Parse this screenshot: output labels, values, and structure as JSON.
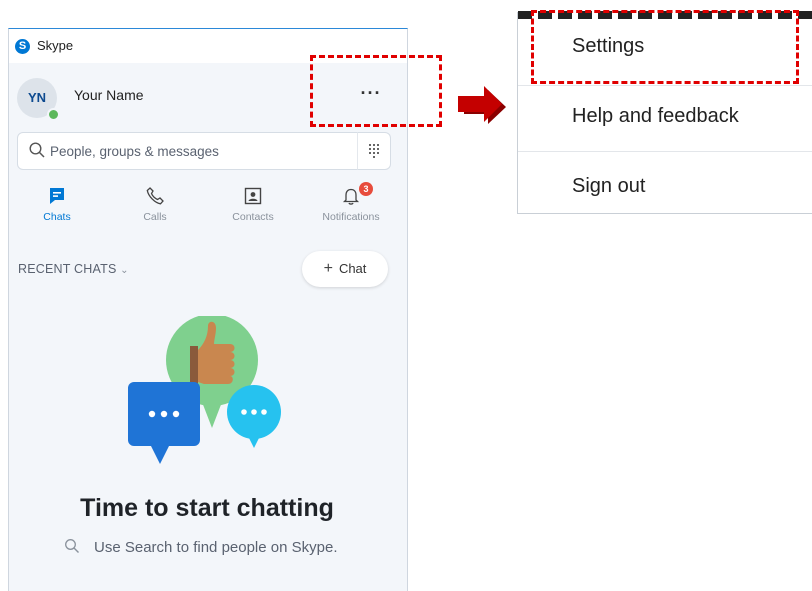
{
  "window": {
    "title": "Skype",
    "logo_letter": "S"
  },
  "profile": {
    "initials": "YN",
    "name": "Your Name",
    "more_label": "···"
  },
  "search": {
    "placeholder": "People, groups & messages"
  },
  "nav_tabs": [
    {
      "label": "Chats",
      "icon": "chat-icon",
      "active": true
    },
    {
      "label": "Calls",
      "icon": "phone-icon"
    },
    {
      "label": "Contacts",
      "icon": "contacts-icon"
    },
    {
      "label": "Notifications",
      "icon": "bell-icon",
      "badge": "3"
    }
  ],
  "recent_chats": {
    "label": "RECENT CHATS",
    "new_chat_label": "Chat"
  },
  "empty_state": {
    "title": "Time to start chatting",
    "subtitle": "Use Search to find people on Skype."
  },
  "menu": {
    "items": [
      "Settings",
      "Help and feedback",
      "Sign out"
    ]
  },
  "colors": {
    "accent": "#0078d4",
    "callout": "#e00000",
    "arrow": "#c40000",
    "badge": "#e74c3c",
    "presence": "#5cb85c"
  }
}
